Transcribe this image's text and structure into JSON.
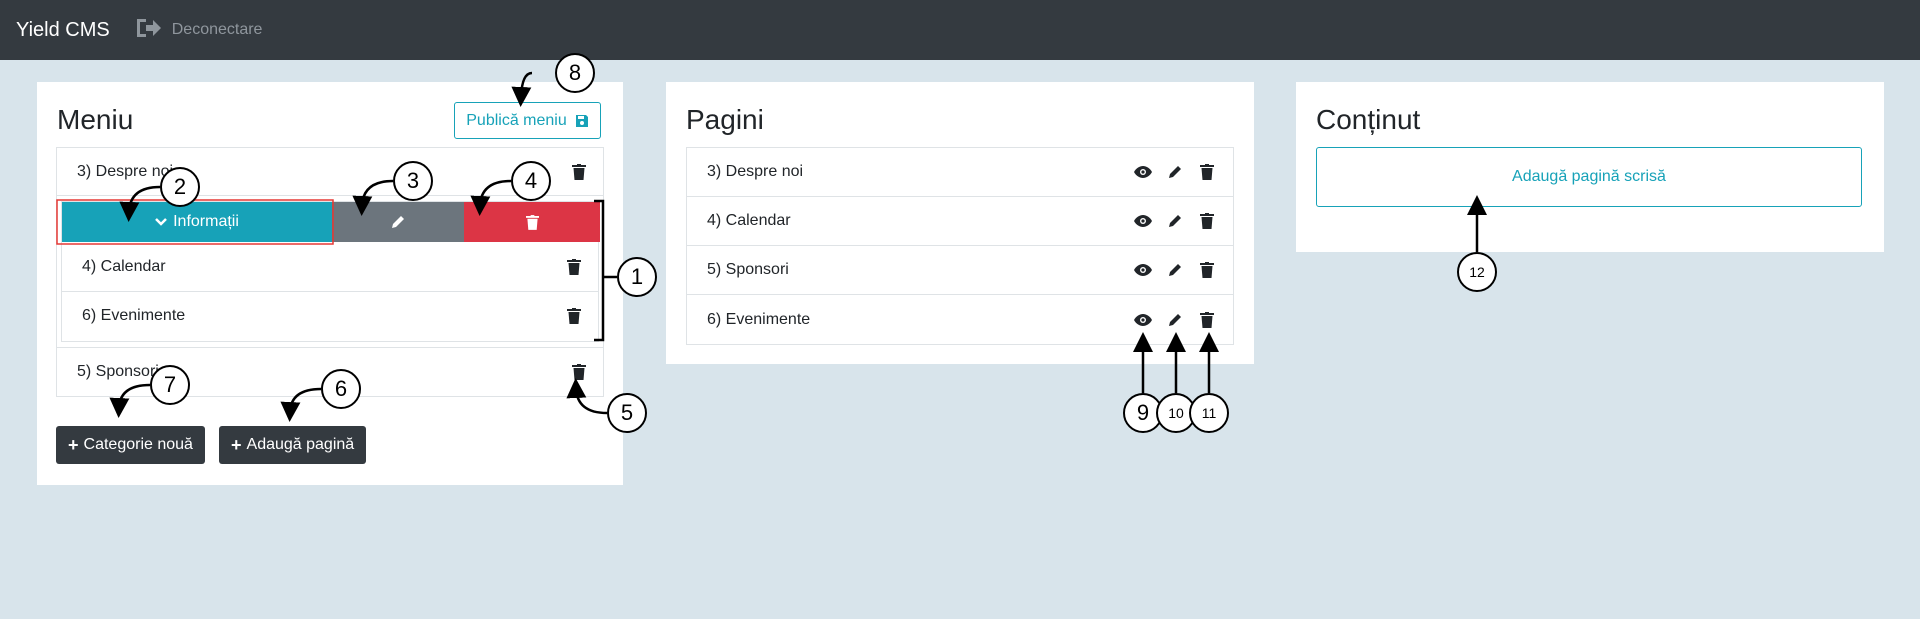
{
  "navbar": {
    "brand": "Yield CMS",
    "logout_label": "Deconectare",
    "logout_icon": "sign-out-icon"
  },
  "menu_panel": {
    "title": "Meniu",
    "publish_label": "Publică meniu",
    "publish_icon": "save-icon",
    "items": [
      {
        "label": "3) Despre noi"
      },
      {
        "label": "5) Sponsori"
      }
    ],
    "category": {
      "label": "Informații",
      "children": [
        {
          "label": "4) Calendar"
        },
        {
          "label": "6) Evenimente"
        }
      ]
    },
    "new_category_label": "Categorie nouă",
    "add_page_label": "Adaugă pagină"
  },
  "pages_panel": {
    "title": "Pagini",
    "items": [
      {
        "label": "3) Despre noi"
      },
      {
        "label": "4) Calendar"
      },
      {
        "label": "5) Sponsori"
      },
      {
        "label": "6) Evenimente"
      }
    ]
  },
  "content_panel": {
    "title": "Conținut",
    "add_written_page_label": "Adaugă pagină scrisă"
  },
  "callouts": [
    "1",
    "2",
    "3",
    "4",
    "5",
    "6",
    "7",
    "8",
    "9",
    "10",
    "11",
    "12"
  ],
  "colors": {
    "navbar": "#343a40",
    "background": "#d8e4eb",
    "info": "#17a2b8",
    "secondary": "#6c757d",
    "danger": "#dc3545",
    "dark": "#343a40"
  }
}
